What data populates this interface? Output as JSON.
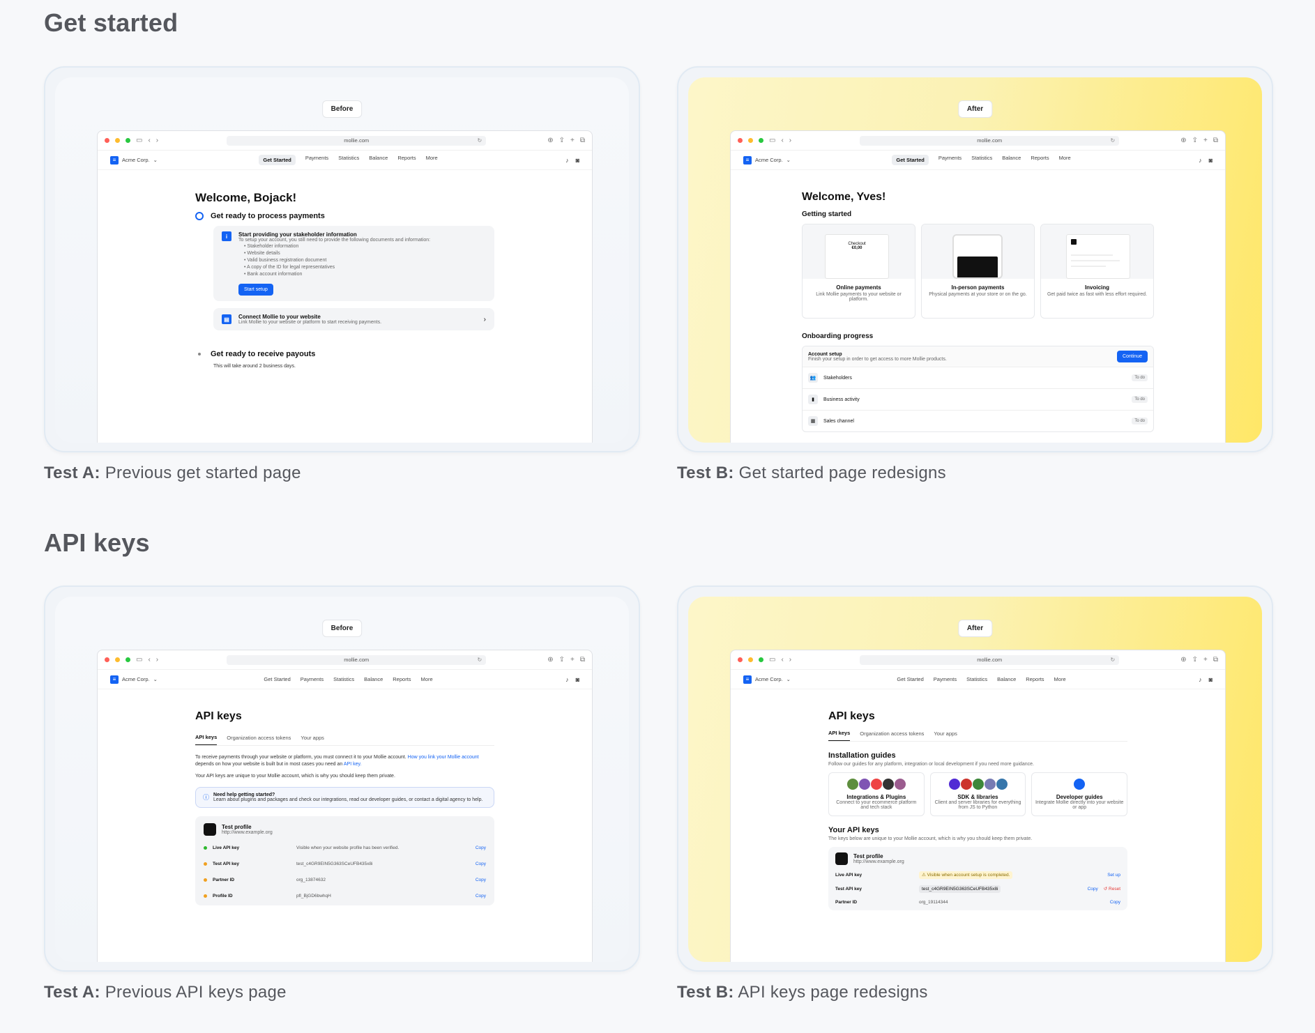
{
  "sections": [
    {
      "title": "Get started"
    },
    {
      "title": "API keys"
    }
  ],
  "labels": {
    "before": "Before",
    "after": "After"
  },
  "browser": {
    "url": "mollie.com",
    "org": "Acme Corp.",
    "nav": [
      "Get Started",
      "Payments",
      "Statistics",
      "Balance",
      "Reports",
      "More"
    ]
  },
  "captions": {
    "a1_bold": "Test A:",
    "a1_text": "Previous get started page",
    "b1_bold": "Test B:",
    "b1_text": "Get started page redesigns",
    "a2_bold": "Test A:",
    "a2_text": "Previous API keys page",
    "b2_bold": "Test B:",
    "b2_text": "API keys page redesigns"
  },
  "gs_before": {
    "welcome": "Welcome, Bojack!",
    "step1": "Get ready to process payments",
    "box1_title": "Start providing your stakeholder information",
    "box1_desc": "To setup your account, you still need to provide the following documents and information:",
    "box1_items": [
      "Stakeholder information",
      "Website details",
      "Valid business registration document",
      "A copy of the ID for legal representatives",
      "Bank account information"
    ],
    "box1_btn": "Start setup",
    "box2_title": "Connect Mollie to your website",
    "box2_desc": "Link Mollie to your website or platform to start receiving payments.",
    "step2": "Get ready to receive payouts",
    "step2_desc": "This will take around 2 business days."
  },
  "gs_after": {
    "welcome": "Welcome, Yves!",
    "getting_started": "Getting started",
    "cards": [
      {
        "title": "Online payments",
        "desc": "Link Mollie payments to your website or platform."
      },
      {
        "title": "In-person payments",
        "desc": "Physical payments at your store or on the go."
      },
      {
        "title": "Invoicing",
        "desc": "Get paid twice as fast with less effort required."
      }
    ],
    "checkout_label": "Checkout",
    "checkout_amount": "€0,00",
    "onboarding": "Onboarding progress",
    "account_setup": "Account setup",
    "account_desc": "Finish your setup in order to get access to more Mollie products.",
    "continue": "Continue",
    "rows": [
      {
        "label": "Stakeholders",
        "status": "To do"
      },
      {
        "label": "Business activity",
        "status": "To do"
      },
      {
        "label": "Sales channel",
        "status": "To do"
      }
    ]
  },
  "api_before": {
    "title": "API keys",
    "tabs": [
      "API keys",
      "Organization access tokens",
      "Your apps"
    ],
    "intro1": "To receive payments through your website or platform, you must connect it to your Mollie account.",
    "intro1_link": "How you link your Mollie account",
    "intro1_tail": "depends on how your website is built but in most cases you need an",
    "intro1_link2": "API key.",
    "intro2": "Your API keys are unique to your Mollie account, which is why you should keep them private.",
    "help_title": "Need help getting started?",
    "help_text": "Learn about plugins and packages and check our integrations, read our developer guides, or contact a digital agency to help.",
    "profile_name": "Test profile",
    "profile_url": "http://www.example.org",
    "keys": [
      {
        "label": "Live API key",
        "value": "Visible when your website profile has been verified.",
        "action": "Copy",
        "color": "#2eb82e"
      },
      {
        "label": "Test API key",
        "value": "test_c4GR9EIN5G363SCeUFB435x8i",
        "action": "Copy",
        "color": "#f0a020"
      },
      {
        "label": "Partner ID",
        "value": "org_13874632",
        "action": "Copy",
        "color": "#f0a020"
      },
      {
        "label": "Profile ID",
        "value": "pfl_BjGD6bwhqH",
        "action": "Copy",
        "color": "#f0a020"
      }
    ]
  },
  "api_after": {
    "title": "API keys",
    "tabs": [
      "API keys",
      "Organization access tokens",
      "Your apps"
    ],
    "install_title": "Installation guides",
    "install_desc": "Follow our guides for any platform, integration or local development if you need more guidance.",
    "guides": [
      {
        "title": "Integrations & Plugins",
        "desc": "Connect to your ecommerce platform and tech stack"
      },
      {
        "title": "SDK & libraries",
        "desc": "Client and server libraries for everything from JS to Python"
      },
      {
        "title": "Developer guides",
        "desc": "Integrate Mollie directly into your website or app"
      }
    ],
    "your_keys": "Your API keys",
    "your_keys_desc": "The keys below are unique to your Mollie account, which is why you should keep them private.",
    "profile_name": "Test profile",
    "profile_url": "http://www.example.org",
    "live_label": "Live API key",
    "live_warn": "Visible when account setup is completed.",
    "live_action": "Set up",
    "test_label": "Test API key",
    "test_value": "test_c4GR9EIN5G363SCeUFB435x8i",
    "test_copy": "Copy",
    "test_reset": "Reset",
    "partner_label": "Partner ID",
    "partner_value": "org_19114344",
    "partner_copy": "Copy"
  }
}
